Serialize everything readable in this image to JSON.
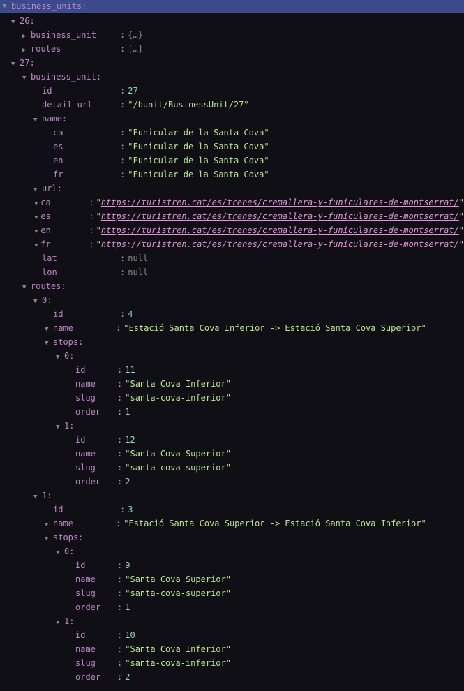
{
  "header": {
    "key": "business_units"
  },
  "bu26": {
    "key": "26",
    "business_unit_key": "business_unit",
    "business_unit_preview": "{…}",
    "routes_key": "routes",
    "routes_preview": "[…]"
  },
  "bu27": {
    "key": "27",
    "business_unit_key": "business_unit",
    "id_key": "id",
    "id_value": "27",
    "detail_url_key": "detail-url",
    "detail_url_value": "/bunit/BusinessUnit/27",
    "name_key": "name",
    "name": {
      "ca_key": "ca",
      "ca_value": "Funicular de la Santa Cova",
      "es_key": "es",
      "es_value": "Funicular de la Santa Cova",
      "en_key": "en",
      "en_value": "Funicular de la Santa Cova",
      "fr_key": "fr",
      "fr_value": "Funicular de la Santa Cova"
    },
    "url_key": "url",
    "url": {
      "ca_key": "ca",
      "ca_value": "https://turistren.cat/es/trenes/cremallera-y-funiculares-de-montserrat/",
      "es_key": "es",
      "es_value": "https://turistren.cat/es/trenes/cremallera-y-funiculares-de-montserrat/",
      "en_key": "en",
      "en_value": "https://turistren.cat/es/trenes/cremallera-y-funiculares-de-montserrat/",
      "fr_key": "fr",
      "fr_value": "https://turistren.cat/es/trenes/cremallera-y-funiculares-de-montserrat/"
    },
    "lat_key": "lat",
    "lat_value": "null",
    "lon_key": "lon",
    "lon_value": "null",
    "routes_key": "routes",
    "routes": [
      {
        "idx": "0",
        "id_key": "id",
        "id_value": "4",
        "name_key": "name",
        "name_value": "Estació Santa Cova Inferior -> Estació Santa Cova Superior",
        "stops_key": "stops",
        "stops": [
          {
            "idx": "0",
            "id_key": "id",
            "id_value": "11",
            "name_key": "name",
            "name_value": "Santa Cova Inferior",
            "slug_key": "slug",
            "slug_value": "santa-cova-inferior",
            "order_key": "order",
            "order_value": "1"
          },
          {
            "idx": "1",
            "id_key": "id",
            "id_value": "12",
            "name_key": "name",
            "name_value": "Santa Cova Superior",
            "slug_key": "slug",
            "slug_value": "santa-cova-superior",
            "order_key": "order",
            "order_value": "2"
          }
        ]
      },
      {
        "idx": "1",
        "id_key": "id",
        "id_value": "3",
        "name_key": "name",
        "name_value": "Estació Santa Cova Superior -> Estació Santa Cova Inferior",
        "stops_key": "stops",
        "stops": [
          {
            "idx": "0",
            "id_key": "id",
            "id_value": "9",
            "name_key": "name",
            "name_value": "Santa Cova Superior",
            "slug_key": "slug",
            "slug_value": "santa-cova-superior",
            "order_key": "order",
            "order_value": "1"
          },
          {
            "idx": "1",
            "id_key": "id",
            "id_value": "10",
            "name_key": "name",
            "name_value": "Santa Cova Inferior",
            "slug_key": "slug",
            "slug_value": "santa-cova-inferior",
            "order_key": "order",
            "order_value": "2"
          }
        ]
      }
    ]
  }
}
